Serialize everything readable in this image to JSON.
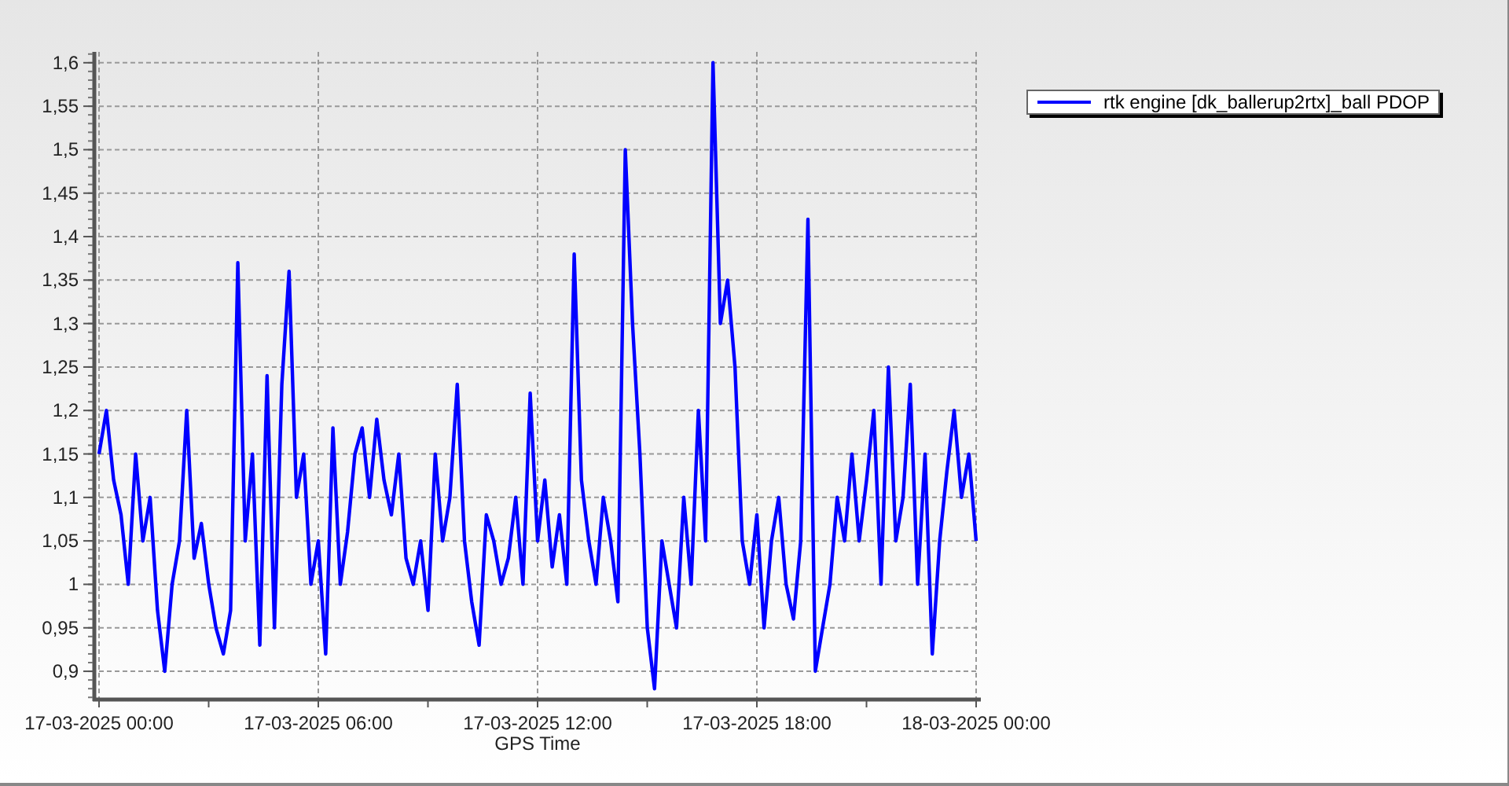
{
  "chart": {
    "chart_data": {
      "type": "line",
      "grid": true,
      "xlabel": "GPS Time",
      "ylim": [
        0.8675,
        1.6125
      ],
      "yticks": [
        {
          "value": 0.9,
          "label": "0,9"
        },
        {
          "value": 0.95,
          "label": "0,95"
        },
        {
          "value": 1,
          "label": "1"
        },
        {
          "value": 1.05,
          "label": "1,05"
        },
        {
          "value": 1.1,
          "label": "1,1"
        },
        {
          "value": 1.15,
          "label": "1,15"
        },
        {
          "value": 1.2,
          "label": "1,2"
        },
        {
          "value": 1.25,
          "label": "1,25"
        },
        {
          "value": 1.3,
          "label": "1,3"
        },
        {
          "value": 1.35,
          "label": "1,35"
        },
        {
          "value": 1.4,
          "label": "1,4"
        },
        {
          "value": 1.45,
          "label": "1,45"
        },
        {
          "value": 1.5,
          "label": "1,5"
        },
        {
          "value": 1.55,
          "label": "1,55"
        },
        {
          "value": 1.6,
          "label": "1,6"
        }
      ],
      "categories": [
        "17-03-2025 00:00",
        null,
        null,
        null,
        null,
        null,
        null,
        null,
        null,
        null,
        null,
        null,
        null,
        null,
        null,
        null,
        null,
        null,
        null,
        null,
        null,
        null,
        null,
        null,
        null,
        null,
        null,
        null,
        null,
        null,
        "17-03-2025 06:00",
        null,
        null,
        null,
        null,
        null,
        null,
        null,
        null,
        null,
        null,
        null,
        null,
        null,
        null,
        null,
        null,
        null,
        null,
        null,
        null,
        null,
        null,
        null,
        null,
        null,
        null,
        null,
        null,
        null,
        "17-03-2025 12:00",
        null,
        null,
        null,
        null,
        null,
        null,
        null,
        null,
        null,
        null,
        null,
        null,
        null,
        null,
        null,
        null,
        null,
        null,
        null,
        null,
        null,
        null,
        null,
        null,
        null,
        null,
        null,
        null,
        null,
        "17-03-2025 18:00",
        null,
        null,
        null,
        null,
        null,
        null,
        null,
        null,
        null,
        null,
        null,
        null,
        null,
        null,
        null,
        null,
        null,
        null,
        null,
        null,
        null,
        null,
        null,
        null,
        null,
        null,
        null,
        null,
        null,
        "18-03-2025 00:00"
      ],
      "series": [
        {
          "name": "rtk engine [dk_ballerup2rtx]_ball PDOP",
          "color": "#0000ff",
          "values": [
            1.15,
            1.2,
            1.12,
            1.08,
            1.0,
            1.15,
            1.05,
            1.1,
            0.97,
            0.9,
            1.0,
            1.05,
            1.2,
            1.03,
            1.07,
            1.0,
            0.95,
            0.92,
            0.97,
            1.37,
            1.05,
            1.15,
            0.93,
            1.24,
            0.95,
            1.23,
            1.36,
            1.1,
            1.15,
            1.0,
            1.05,
            0.92,
            1.18,
            1.0,
            1.06,
            1.15,
            1.18,
            1.1,
            1.19,
            1.12,
            1.08,
            1.15,
            1.03,
            1.0,
            1.05,
            0.97,
            1.15,
            1.05,
            1.1,
            1.23,
            1.05,
            0.98,
            0.93,
            1.08,
            1.05,
            1.0,
            1.03,
            1.1,
            1.0,
            1.22,
            1.05,
            1.12,
            1.02,
            1.08,
            1.0,
            1.38,
            1.12,
            1.05,
            1.0,
            1.1,
            1.05,
            0.98,
            1.5,
            1.3,
            1.15,
            0.95,
            0.88,
            1.05,
            1.0,
            0.95,
            1.1,
            1.0,
            1.2,
            1.05,
            1.6,
            1.3,
            1.35,
            1.25,
            1.05,
            1.0,
            1.08,
            0.95,
            1.05,
            1.1,
            1.0,
            0.96,
            1.05,
            1.42,
            0.9,
            0.95,
            1.0,
            1.1,
            1.05,
            1.15,
            1.05,
            1.12,
            1.2,
            1.0,
            1.25,
            1.05,
            1.1,
            1.23,
            1.0,
            1.15,
            0.92,
            1.05,
            1.13,
            1.2,
            1.1,
            1.15,
            1.05
          ]
        }
      ]
    }
  }
}
